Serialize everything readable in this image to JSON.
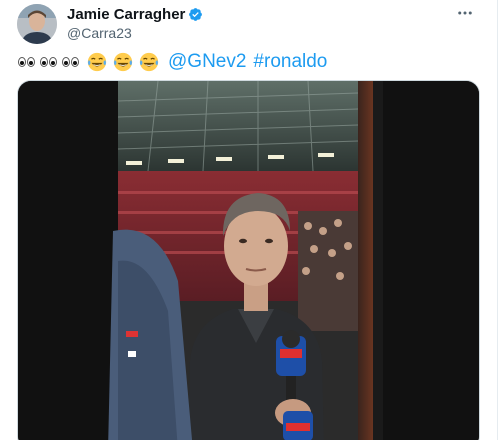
{
  "tweet": {
    "author_name": "Jamie Carragher",
    "handle": "@Carra23",
    "verified": true,
    "text_prefix_icons": [
      "eyes-icon",
      "eyes-icon",
      "eyes-icon",
      "laughing-tears-icon",
      "laughing-tears-icon",
      "laughing-tears-icon"
    ],
    "mention": "@GNev2",
    "hashtag": "#ronaldo",
    "more_icon": "more-horizontal-icon",
    "link_color": "#1d9bf0"
  }
}
